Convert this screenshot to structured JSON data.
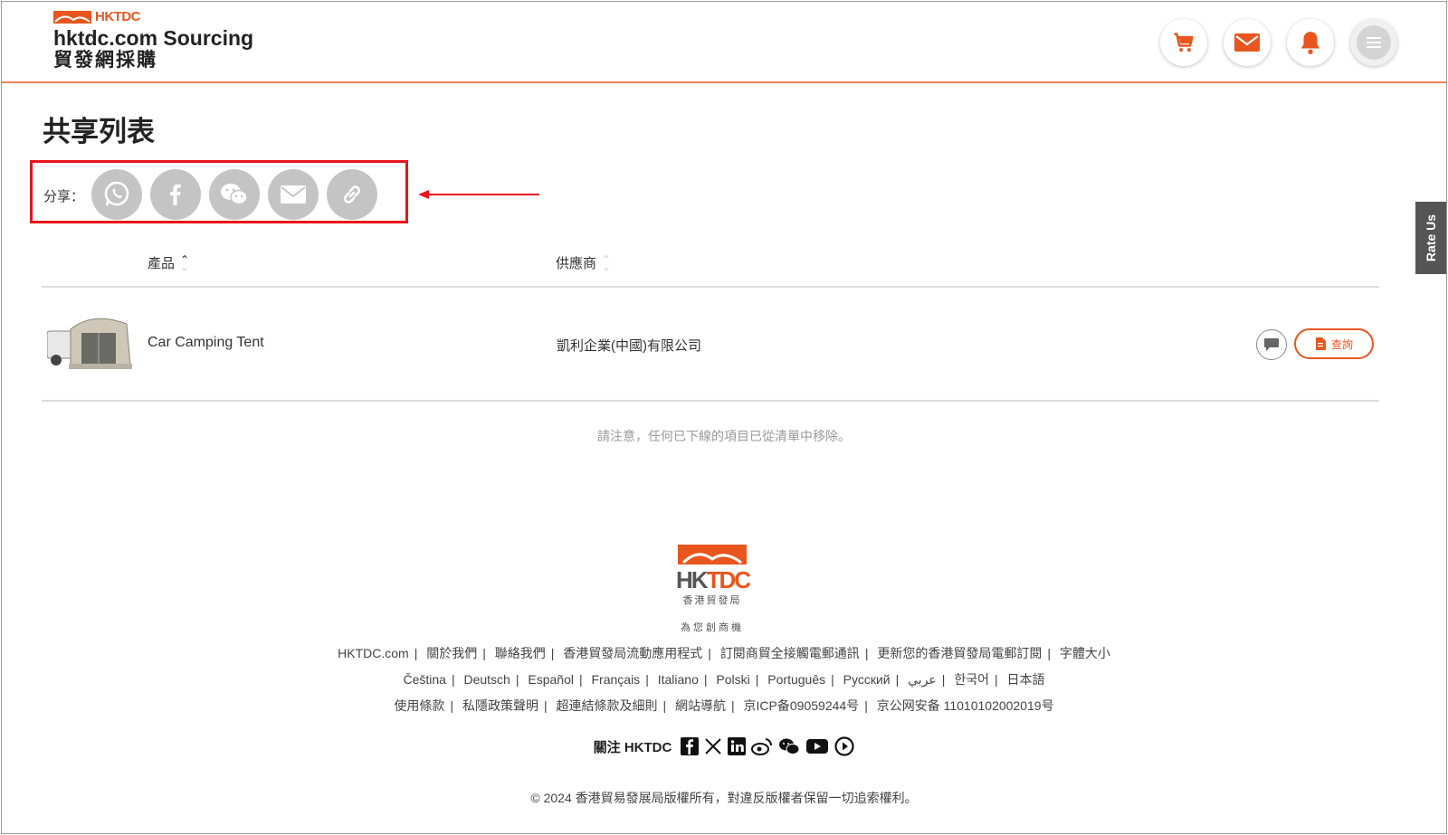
{
  "header": {
    "logo_mark": "HKTDC",
    "brand": "hktdc.com Sourcing",
    "brand_cn": "貿發網採購",
    "icons": [
      "cart-icon",
      "mail-icon",
      "bell-icon",
      "menu-icon"
    ],
    "accent": "#e8561e"
  },
  "page": {
    "title": "共享列表",
    "share_label": "分享："
  },
  "share_icons": [
    "whatsapp-icon",
    "facebook-icon",
    "wechat-icon",
    "email-icon",
    "link-icon"
  ],
  "rate_us": "Rate Us",
  "table": {
    "columns": [
      "產品",
      "供應商"
    ],
    "rows": [
      {
        "product": "Car Camping Tent",
        "supplier": "凱利企業(中國)有限公司",
        "inquire_label": "查詢"
      }
    ]
  },
  "notice": "請注意，任何已下線的項目已從清單中移除。",
  "footer": {
    "logo_hk": "HK",
    "logo_tdc": "TDC",
    "logo_cn": "香港貿發局",
    "tagline": "為您創商機",
    "links_row1": [
      "HKTDC.com",
      "關於我們",
      "聯絡我們",
      "香港貿發局流動應用程式",
      "訂閱商貿全接觸電郵通訊",
      "更新您的香港貿發局電郵訂閱",
      "字體大小"
    ],
    "links_row2": [
      "Čeština",
      "Deutsch",
      "Español",
      "Français",
      "Italiano",
      "Polski",
      "Português",
      "Русский",
      "عربي",
      "한국어",
      "日本語"
    ],
    "links_row3": [
      "使用條款",
      "私隱政策聲明",
      "超連結條款及細則",
      "網站導航",
      "京ICP备09059244号",
      "京公网安备 11010102002019号"
    ],
    "follow_label": "關注 HKTDC",
    "social_icons": [
      "facebook-icon",
      "x-icon",
      "linkedin-icon",
      "weibo-icon",
      "wechat-icon",
      "youtube-icon",
      "play-icon"
    ],
    "copyright": "© 2024   香港貿易發展局版權所有，對違反版權者保留一切追索權利。"
  }
}
